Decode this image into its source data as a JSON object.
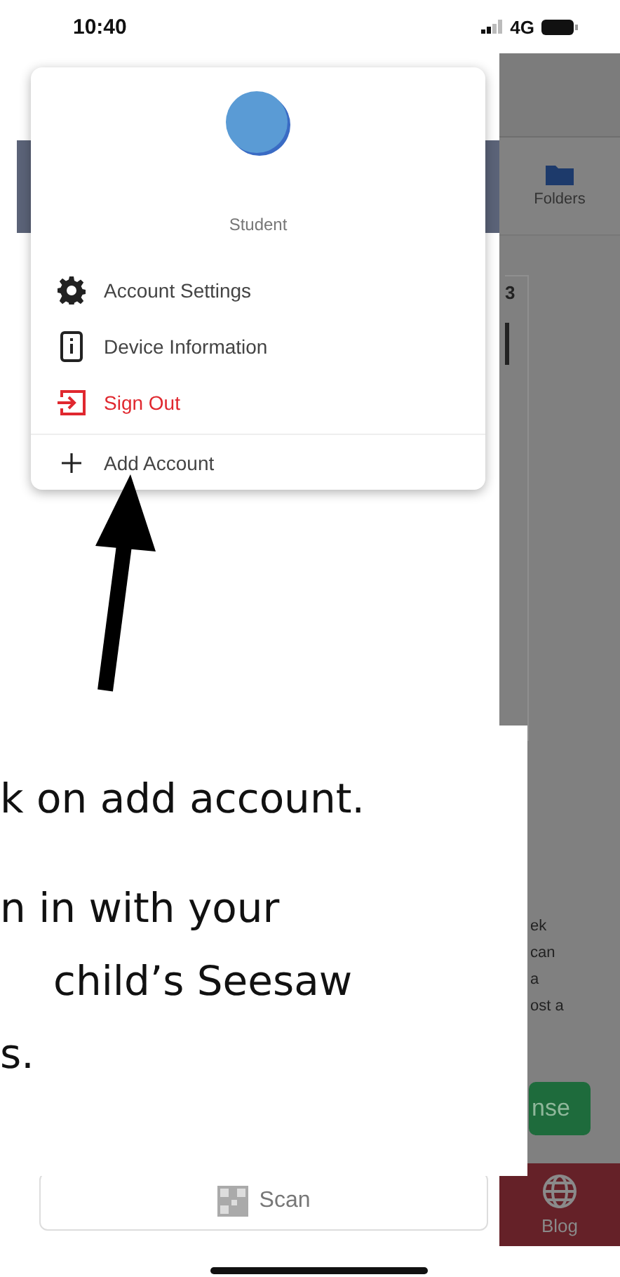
{
  "status_bar": {
    "time": "10:40",
    "network": "4G"
  },
  "background_app": {
    "tabs": [
      {
        "label": "Folders",
        "kind": "folders"
      },
      {
        "label": "Blog",
        "kind": "blog"
      }
    ],
    "badge": "3",
    "snippet_lines": [
      "ek",
      "can",
      "a",
      "ost a"
    ],
    "response_button": "nse",
    "scan_button": "Scan"
  },
  "account_menu": {
    "role": "Student",
    "items": [
      {
        "kind": "settings",
        "label": "Account Settings",
        "destructive": false
      },
      {
        "kind": "device",
        "label": "Device Information",
        "destructive": false
      },
      {
        "kind": "signout",
        "label": "Sign Out",
        "destructive": true
      }
    ],
    "add_account": "Add Account"
  },
  "annotation": {
    "lines": [
      {
        "text": "k on add account.",
        "indented": false
      },
      {
        "text": "n in with your",
        "indented": false
      },
      {
        "text": "child’s Seesaw",
        "indented": true
      },
      {
        "text": "s.",
        "indented": false
      }
    ]
  }
}
